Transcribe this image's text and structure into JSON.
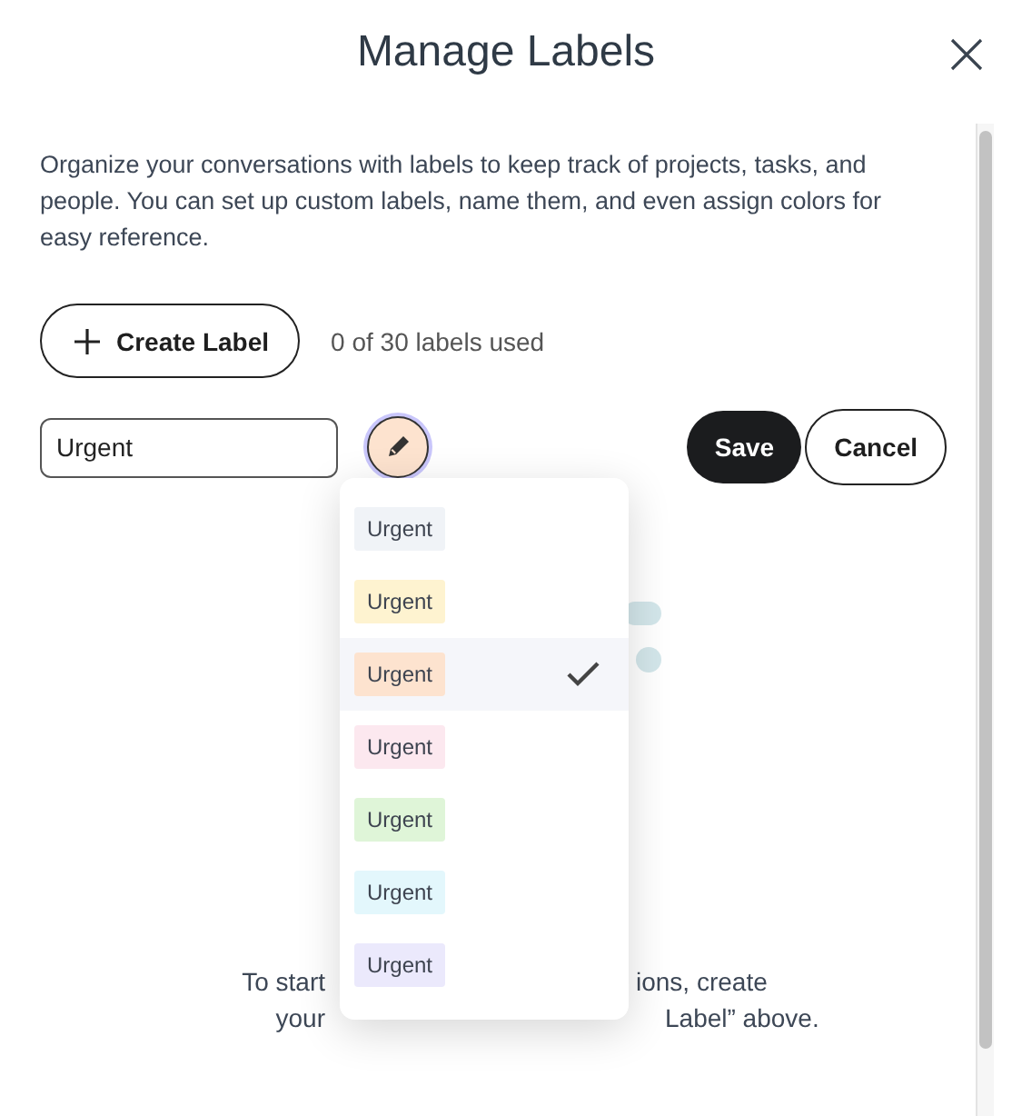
{
  "dialog": {
    "title": "Manage Labels",
    "description": "Organize your conversations with labels to keep track of projects, tasks, and people. You can set up custom labels, name them, and even assign colors for easy reference."
  },
  "create_button": {
    "label": "Create Label"
  },
  "usage": "0 of 30 labels used",
  "editor": {
    "name_value": "Urgent",
    "save": "Save",
    "cancel": "Cancel"
  },
  "color_options": [
    {
      "label": "Urgent",
      "color": "#f0f3f7",
      "selected": false
    },
    {
      "label": "Urgent",
      "color": "#fef3d0",
      "selected": false
    },
    {
      "label": "Urgent",
      "color": "#fde3cf",
      "selected": true
    },
    {
      "label": "Urgent",
      "color": "#fce8ef",
      "selected": false
    },
    {
      "label": "Urgent",
      "color": "#dff5d8",
      "selected": false
    },
    {
      "label": "Urgent",
      "color": "#e3f7fc",
      "selected": false
    },
    {
      "label": "Urgent",
      "color": "#ebe9fc",
      "selected": false
    }
  ],
  "empty_state": {
    "line1_left": "To start",
    "line1_right": "ions, create",
    "line2_left": "your",
    "line2_right": "Label” above."
  }
}
